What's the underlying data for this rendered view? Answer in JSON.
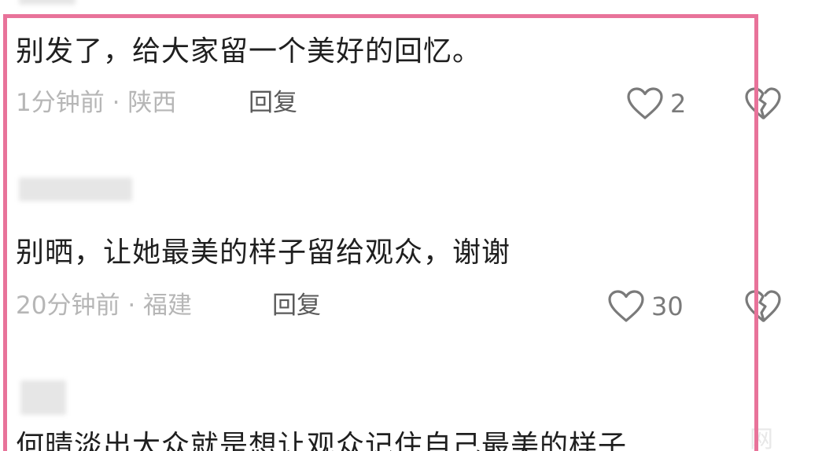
{
  "comments": [
    {
      "text": "别发了，给大家留一个美好的回忆。",
      "time": "1分钟前",
      "separator": "·",
      "location": "陕西",
      "reply_label": "回复",
      "likes": "2"
    },
    {
      "text": "别晒，让她最美的样子留给观众，谢谢",
      "time": "20分钟前",
      "separator": "·",
      "location": "福建",
      "reply_label": "回复",
      "likes": "30"
    },
    {
      "text": "何晴淡出大众就是想让观众记住自己最美的样子"
    }
  ],
  "watermark": "网",
  "colors": {
    "highlight": "#e8739a",
    "text": "#1f1f1f",
    "meta": "#b6b6b6",
    "reply": "#5a5a5a"
  },
  "icons": {
    "like": "heart-outline-icon",
    "dislike": "broken-heart-icon"
  }
}
